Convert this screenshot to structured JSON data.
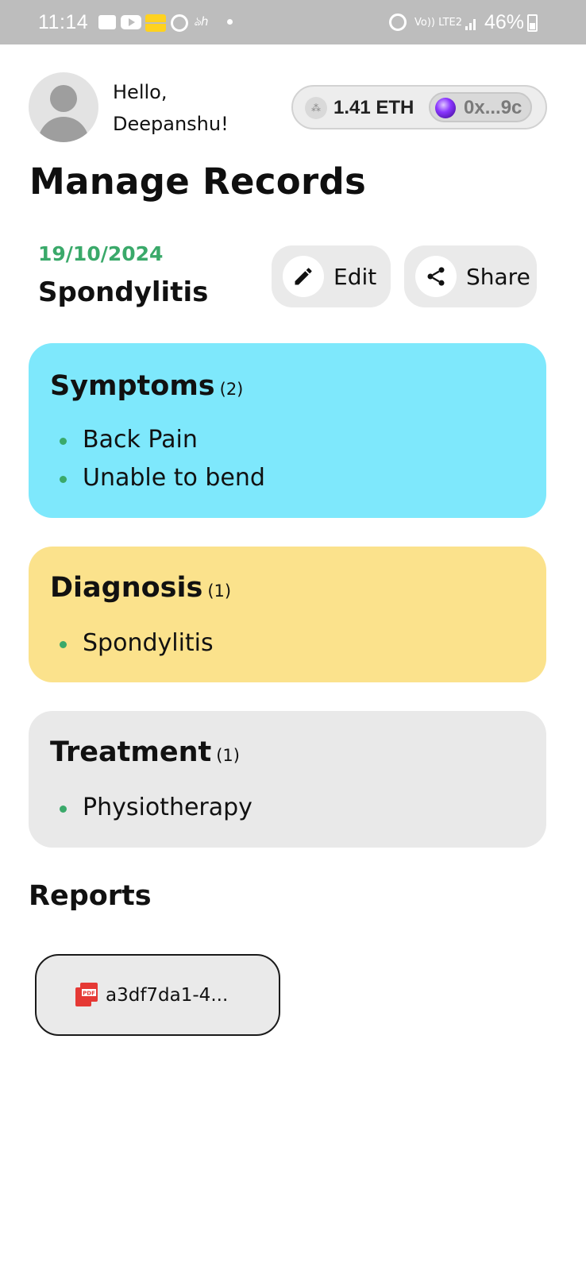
{
  "status_bar": {
    "time": "11:14",
    "battery": "46%",
    "icons": [
      "message-icon",
      "youtube-icon",
      "app-icon",
      "chat-icon",
      "dh-icon",
      "dot-icon",
      "alarm-icon",
      "wifi-icon",
      "signal-icon",
      "battery-icon"
    ],
    "network": "Vo)) LTE2",
    "dh_text": "ঌh"
  },
  "header": {
    "greeting_line1": "Hello,",
    "greeting_line2": "Deepanshu!",
    "wallet": {
      "balance": "1.41 ETH",
      "address": "0x...9c"
    }
  },
  "page_title": "Manage Records",
  "record": {
    "date": "19/10/2024",
    "name": "Spondylitis",
    "actions": {
      "edit_label": "Edit",
      "share_label": "Share"
    }
  },
  "sections": {
    "symptoms": {
      "title": "Symptoms",
      "count": "(2)",
      "items": [
        "Back Pain",
        "Unable to bend"
      ],
      "color": "#7ee8fc"
    },
    "diagnosis": {
      "title": "Diagnosis",
      "count": "(1)",
      "items": [
        "Spondylitis"
      ],
      "color": "#fbe28c"
    },
    "treatment": {
      "title": "Treatment",
      "count": "(1)",
      "items": [
        "Physiotherapy"
      ],
      "color": "#e9e9e9"
    }
  },
  "reports": {
    "title": "Reports",
    "files": [
      {
        "name": "a3df7da1-4...",
        "icon": "pdf-icon"
      }
    ]
  },
  "colors": {
    "accent_green": "#3aa96a",
    "pdf_red": "#e53935"
  }
}
